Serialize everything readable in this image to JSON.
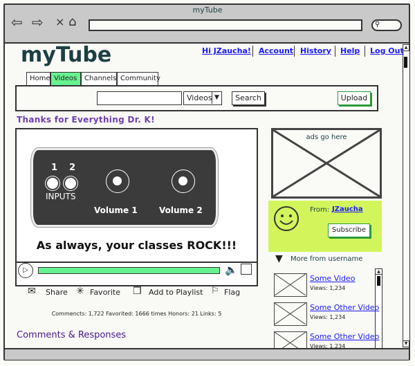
{
  "window": {
    "title": "myTube"
  },
  "browser": {
    "address_value": "",
    "icons": [
      "back-arrow-icon",
      "forward-arrow-icon",
      "stop-icon",
      "home-icon",
      "search-icon"
    ]
  },
  "header": {
    "logo": "myTube",
    "links": [
      "Hi JZaucha!",
      "Account",
      "History",
      "Help",
      "Log Out"
    ]
  },
  "tabs": [
    {
      "label": "Home",
      "active": false
    },
    {
      "label": "Videos",
      "active": true
    },
    {
      "label": "Channels",
      "active": false
    },
    {
      "label": "Community",
      "active": false
    }
  ],
  "toolbar": {
    "search_value": "",
    "category": "Videos",
    "search_label": "Search",
    "upload_label": "Upload"
  },
  "video": {
    "title": "Thanks for Everything Dr. K!",
    "image_text": {
      "inputs": "INPUTS",
      "input1": "1",
      "input2": "2",
      "vol1": "Volume 1",
      "vol2": "Volume 2"
    },
    "caption": "As always, your classes ROCK!!!",
    "progress": 1.0
  },
  "actions": [
    "Share",
    "Favorite",
    "Add to Playlist",
    "Flag"
  ],
  "stats": "Commencts: 1,722 Favorited: 1666 times Honors: 21 Links: 5",
  "comments_heading": "Comments & Responses",
  "ad": {
    "text": "ads go here"
  },
  "uploader": {
    "from_label": "From:",
    "name": "JZaucha",
    "subscribe_label": "Subscribe"
  },
  "more": {
    "heading": "More from username",
    "items": [
      {
        "title": "Some Video",
        "views": "Views: 1,234"
      },
      {
        "title": "Some Other Video",
        "views": "Views: 1,234"
      },
      {
        "title": "Some Other Video",
        "views": "Views: 1,234"
      }
    ]
  },
  "colors": {
    "accent_green": "#66f28f",
    "title_purple": "#6f3fb0",
    "link_blue": "#1a1aff",
    "uploader_bg": "#d2f55c"
  }
}
